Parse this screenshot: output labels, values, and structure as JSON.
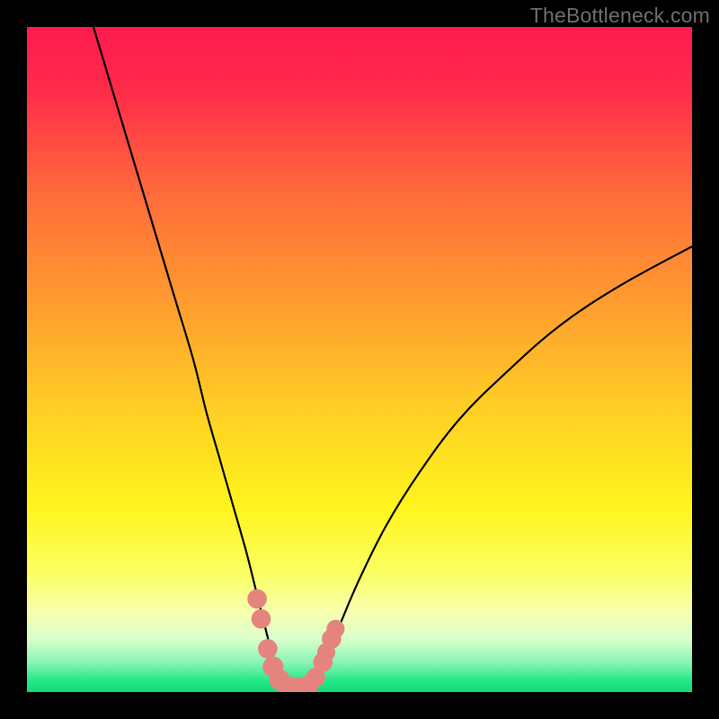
{
  "watermark": "TheBottleneck.com",
  "colors": {
    "frame": "#000000",
    "gradient_stops": [
      {
        "offset": 0.0,
        "color": "#ff1a4f"
      },
      {
        "offset": 0.1,
        "color": "#ff2d49"
      },
      {
        "offset": 0.25,
        "color": "#ff6b3a"
      },
      {
        "offset": 0.42,
        "color": "#ff9e2f"
      },
      {
        "offset": 0.58,
        "color": "#ffd024"
      },
      {
        "offset": 0.72,
        "color": "#fff41c"
      },
      {
        "offset": 0.82,
        "color": "#fbff60"
      },
      {
        "offset": 0.88,
        "color": "#f8ffb0"
      },
      {
        "offset": 0.92,
        "color": "#d9ffca"
      },
      {
        "offset": 0.955,
        "color": "#8af5b5"
      },
      {
        "offset": 0.985,
        "color": "#1fe783"
      },
      {
        "offset": 1.0,
        "color": "#17d976"
      }
    ],
    "curve": "#000000",
    "marker_fill": "#e5847e",
    "marker_stroke": "#c96b66"
  },
  "chart_data": {
    "type": "line",
    "title": "",
    "xlabel": "",
    "ylabel": "",
    "xlim": [
      0,
      100
    ],
    "ylim": [
      0,
      100
    ],
    "series": [
      {
        "name": "bottleneck-curve",
        "x": [
          10,
          13,
          16,
          19,
          22,
          25,
          27,
          29,
          31,
          33,
          34.5,
          35.5,
          36.5,
          37.3,
          38,
          38.6,
          40.5,
          42.5,
          43.5,
          45,
          47,
          50,
          54,
          59,
          65,
          72,
          80,
          89,
          100
        ],
        "y": [
          100,
          90,
          80,
          70,
          60,
          50,
          42,
          35,
          28,
          21,
          15,
          11,
          7,
          4,
          2,
          0.5,
          0.3,
          0.5,
          2,
          5,
          10,
          17,
          25,
          33,
          41,
          48,
          55,
          61,
          67
        ]
      }
    ],
    "markers": [
      {
        "x": 34.6,
        "y": 14.0,
        "r": 1.3
      },
      {
        "x": 35.2,
        "y": 11.0,
        "r": 1.3
      },
      {
        "x": 36.2,
        "y": 6.5,
        "r": 1.3
      },
      {
        "x": 37.0,
        "y": 3.8,
        "r": 1.5
      },
      {
        "x": 38.0,
        "y": 1.8,
        "r": 1.5
      },
      {
        "x": 39.3,
        "y": 0.8,
        "r": 1.5
      },
      {
        "x": 40.8,
        "y": 0.6,
        "r": 1.5
      },
      {
        "x": 42.2,
        "y": 0.9,
        "r": 1.5
      },
      {
        "x": 43.4,
        "y": 2.2,
        "r": 1.3
      },
      {
        "x": 44.5,
        "y": 4.5,
        "r": 1.3
      },
      {
        "x": 45.0,
        "y": 6.0,
        "r": 1.1
      },
      {
        "x": 45.8,
        "y": 8.0,
        "r": 1.3
      },
      {
        "x": 46.4,
        "y": 9.5,
        "r": 1.1
      }
    ]
  }
}
